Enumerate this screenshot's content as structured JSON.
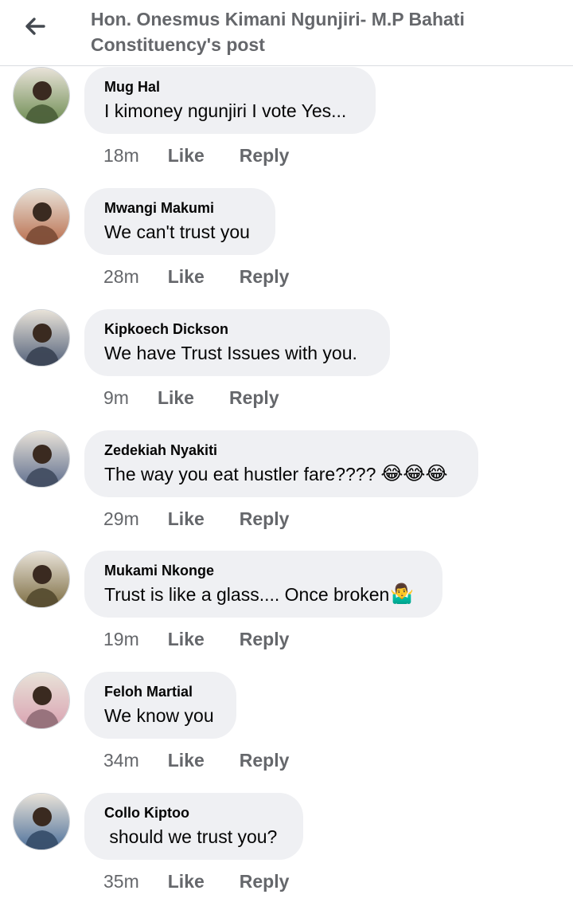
{
  "header": {
    "title": "Hon. Onesmus Kimani Ngunjiri- M.P Bahati Constituency's post"
  },
  "comments": [
    {
      "author": "Mug Hal",
      "text": "I kimoney ngunjiri I vote Yes...",
      "time": "18m",
      "like_label": "Like",
      "reply_label": "Reply",
      "avatar_color": "#6a8a4e"
    },
    {
      "author": "Mwangi Makumi",
      "text": "We can't trust you",
      "time": "28m",
      "like_label": "Like",
      "reply_label": "Reply",
      "avatar_color": "#b86b4a"
    },
    {
      "author": "Kipkoech Dickson",
      "text": "We have Trust Issues with you.",
      "time": "9m",
      "like_label": "Like",
      "reply_label": "Reply",
      "avatar_color": "#4f5e78"
    },
    {
      "author": "Zedekiah Nyakiti",
      "text": "The way you eat hustler fare????",
      "emoji": "😂😂😂",
      "time": "29m",
      "like_label": "Like",
      "reply_label": "Reply",
      "avatar_color": "#5b6b8c"
    },
    {
      "author": "Mukami Nkonge",
      "text": "Trust is like a glass.... Once broken",
      "emoji": "🤷‍♂️",
      "time": "19m",
      "like_label": "Like",
      "reply_label": "Reply",
      "avatar_color": "#7a6a3e"
    },
    {
      "author": "Feloh Martial",
      "text": "We know you",
      "time": "34m",
      "like_label": "Like",
      "reply_label": "Reply",
      "avatar_color": "#d9a0b0"
    },
    {
      "author": "Collo Kiptoo",
      "text": " should we trust you?",
      "time": "35m",
      "like_label": "Like",
      "reply_label": "Reply",
      "avatar_color": "#4a6e9a"
    }
  ],
  "colors": {
    "bubble_bg": "#eff0f3",
    "meta_text": "#65676b",
    "primary_text": "#050505"
  }
}
